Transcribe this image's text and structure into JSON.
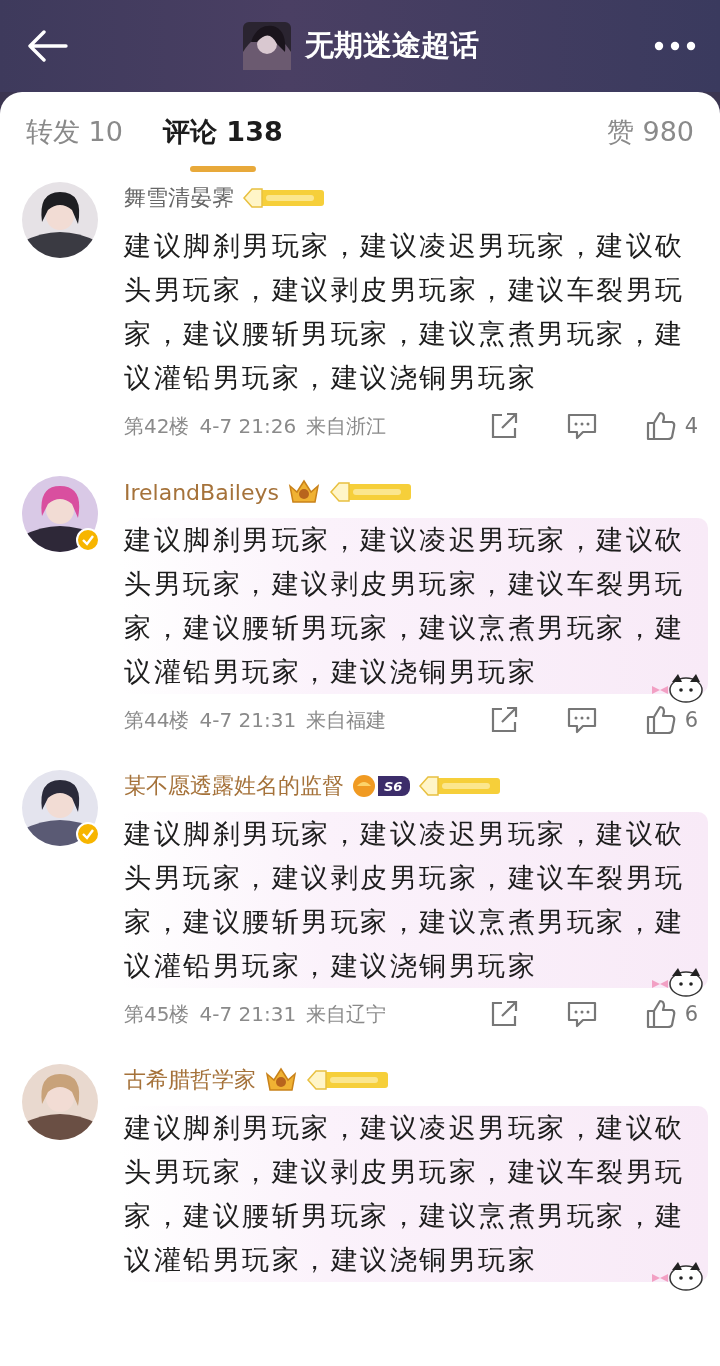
{
  "header": {
    "title": "无期迷途超话"
  },
  "tabs": [
    {
      "label": "转发 10",
      "selected": false
    },
    {
      "label": "评论 138",
      "selected": true
    },
    {
      "label": "赞 980",
      "selected": false
    }
  ],
  "comments": [
    {
      "name": "舞雪清晏霁",
      "vip": false,
      "verified": false,
      "bubble": false,
      "badges": [
        {
          "kind": "medal"
        }
      ],
      "text": "建议脚刹男玩家，建议凌迟男玩家，建议砍头男玩家，建议剥皮男玩家，建议车裂男玩家，建议腰斩男玩家，建议烹煮男玩家，建议灌铅男玩家，建议浇铜男玩家",
      "floor": "第42楼",
      "time": "4-7 21:26",
      "location": "来自浙江",
      "likes": "4"
    },
    {
      "name": "IrelandBaileys",
      "vip": true,
      "verified": true,
      "bubble": true,
      "badges": [
        {
          "kind": "crown"
        },
        {
          "kind": "medal"
        }
      ],
      "text": "建议脚刹男玩家，建议凌迟男玩家，建议砍头男玩家，建议剥皮男玩家，建议车裂男玩家，建议腰斩男玩家，建议烹煮男玩家，建议灌铅男玩家，建议浇铜男玩家",
      "floor": "第44楼",
      "time": "4-7 21:31",
      "location": "来自福建",
      "likes": "6"
    },
    {
      "name": "某不愿透露姓名的监督",
      "vip": true,
      "verified": true,
      "bubble": true,
      "badges": [
        {
          "kind": "season",
          "text": "S6"
        },
        {
          "kind": "medal"
        }
      ],
      "text": "建议脚刹男玩家，建议凌迟男玩家，建议砍头男玩家，建议剥皮男玩家，建议车裂男玩家，建议腰斩男玩家，建议烹煮男玩家，建议灌铅男玩家，建议浇铜男玩家",
      "floor": "第45楼",
      "time": "4-7 21:31",
      "location": "来自辽宁",
      "likes": "6"
    },
    {
      "name": "古希腊哲学家",
      "vip": true,
      "verified": false,
      "bubble": true,
      "badges": [
        {
          "kind": "crown"
        },
        {
          "kind": "medal"
        }
      ],
      "text": "建议脚刹男玩家，建议凌迟男玩家，建议砍头男玩家，建议剥皮男玩家，建议车裂男玩家，建议腰斩男玩家，建议烹煮男玩家，建议灌铅男玩家，建议浇铜男玩家"
    }
  ]
}
